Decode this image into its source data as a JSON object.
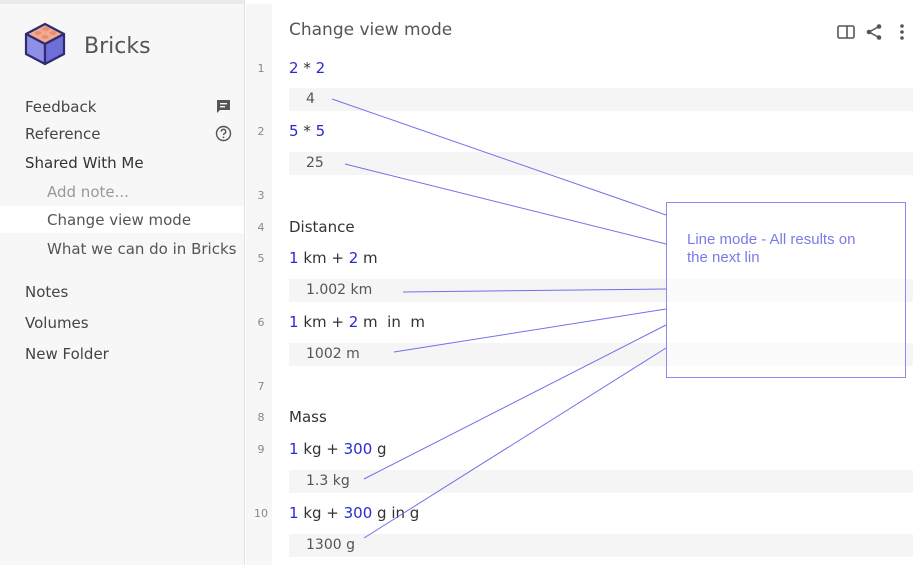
{
  "app": {
    "name": "Bricks"
  },
  "sidebar": {
    "items": [
      {
        "label": "Feedback"
      },
      {
        "label": "Reference"
      },
      {
        "label": "Shared With Me"
      },
      {
        "label": "Add note..."
      },
      {
        "label": "Change view mode"
      },
      {
        "label": "What we can do in Bricks"
      },
      {
        "label": "Notes"
      },
      {
        "label": "Volumes"
      },
      {
        "label": "New Folder"
      }
    ]
  },
  "note": {
    "title": "Change view mode",
    "lines": [
      {
        "n": "1",
        "a": "2",
        "op": " * ",
        "b": "2",
        "result": "4"
      },
      {
        "n": "2",
        "a": "5",
        "op": " * ",
        "b": "5",
        "result": "25"
      },
      {
        "n": "3"
      },
      {
        "n": "4",
        "heading": "Distance"
      },
      {
        "n": "5",
        "a": "1",
        "t1": " km + ",
        "b": "2",
        "t2": " m",
        "result": "1.002 km"
      },
      {
        "n": "6",
        "a": "1",
        "t1": " km + ",
        "b": "2",
        "t2": " m  in  m",
        "result": "1002 m"
      },
      {
        "n": "7"
      },
      {
        "n": "8",
        "heading": "Mass"
      },
      {
        "n": "9",
        "a": "1",
        "t1": " kg + ",
        "b": "300",
        "t2": " g",
        "result": "1.3 kg"
      },
      {
        "n": "10",
        "a": "1",
        "t1": " kg + ",
        "b": "300",
        "t2": " g in g",
        "result": "1300 g"
      }
    ]
  },
  "callout": {
    "text": "Line mode - All results on the next lin"
  },
  "colors": {
    "number": "#2a2ad0",
    "annotation": "#7a7ae8"
  },
  "icons": [
    "cube-logo-icon",
    "feedback-icon",
    "help-icon",
    "panel-toggle-icon",
    "share-icon",
    "more-vertical-icon"
  ]
}
